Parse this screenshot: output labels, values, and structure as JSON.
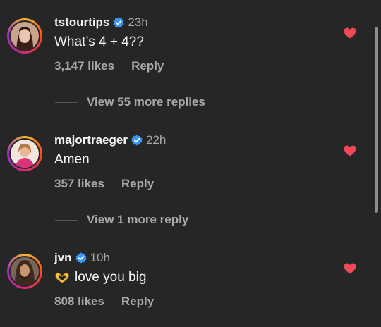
{
  "comments": [
    {
      "username": "tstourtips",
      "time": "23h",
      "text": "What’s 4 + 4??",
      "likes": "3,147 likes",
      "reply_label": "Reply",
      "avatar_icon": "avatar-portrait",
      "heart_color": "#ed4956"
    },
    {
      "username": "majortraeger",
      "time": "22h",
      "text": "Amen",
      "likes": "357 likes",
      "reply_label": "Reply",
      "avatar_icon": "avatar-portrait",
      "heart_color": "#ed4956"
    },
    {
      "username": "jvn",
      "time": "10h",
      "emoji": "🫶",
      "text": "love you big",
      "likes": "808 likes",
      "reply_label": "Reply",
      "avatar_icon": "avatar-portrait",
      "heart_color": "#ed4956"
    }
  ],
  "view_more": [
    {
      "label": "View 55 more replies"
    },
    {
      "label": "View 1 more reply"
    }
  ],
  "colors": {
    "background": "#262626",
    "verified_badge": "#3897f0",
    "muted_text": "#a8a8a8"
  }
}
